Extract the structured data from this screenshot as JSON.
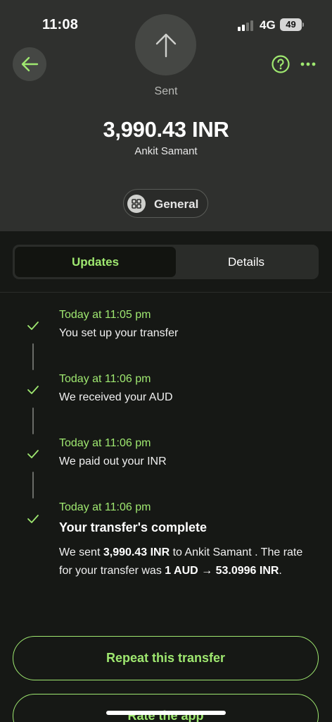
{
  "status_bar": {
    "time": "11:08",
    "network": "4G",
    "battery": "49"
  },
  "header": {
    "status_label": "Sent",
    "amount": "3,990.43 INR",
    "recipient": "Ankit Samant",
    "category": "General"
  },
  "tabs": [
    {
      "label": "Updates",
      "active": true
    },
    {
      "label": "Details",
      "active": false
    }
  ],
  "steps": [
    {
      "time": "Today at 11:05 pm",
      "text": "You set up your transfer"
    },
    {
      "time": "Today at 11:06 pm",
      "text": "We received your AUD"
    },
    {
      "time": "Today at 11:06 pm",
      "text": "We paid out your INR"
    },
    {
      "time": "Today at 11:06 pm",
      "title": "Your transfer's complete",
      "desc": {
        "p1": "We sent ",
        "amount": "3,990.43 INR",
        "p2": " to Ankit Samant . The rate for your transfer was ",
        "rate": "1 AUD → 53.0996 INR",
        "p3": "."
      }
    }
  ],
  "buttons": {
    "repeat": "Repeat this transfer",
    "rate": "Rate the app"
  },
  "colors": {
    "accent": "#9fe870",
    "header_bg": "#2f302e",
    "page_bg": "#161815"
  }
}
